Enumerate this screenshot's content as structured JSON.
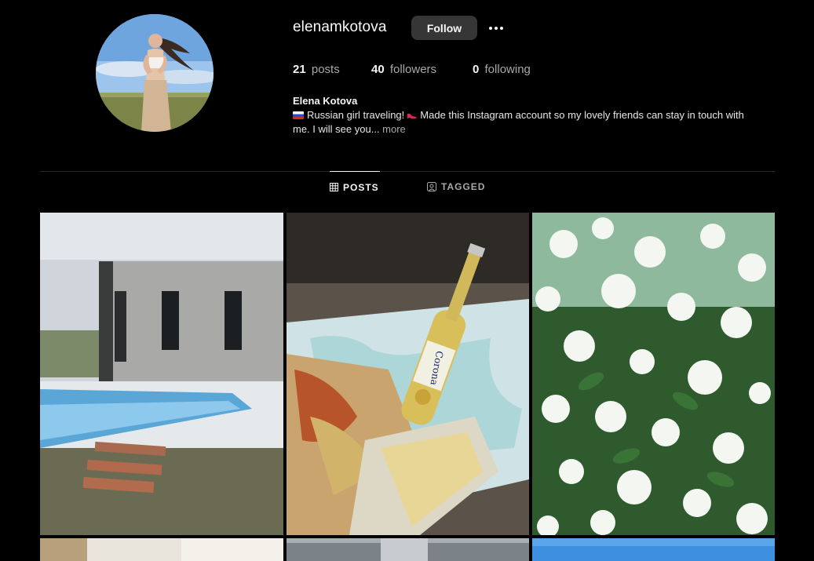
{
  "profile": {
    "username": "elenamkotova",
    "follow_label": "Follow",
    "full_name": "Elena Kotova",
    "bio_text": "Russian girl traveling! 👠 Made this Instagram account so my lovely friends can stay in touch with me. I will see you...",
    "bio_before_emoji": "Russian girl traveling!",
    "bio_after_emoji": "Made this Instagram account so my lovely friends can stay in touch with me. I will see you...",
    "more_label": "more"
  },
  "stats": {
    "posts": {
      "count": "21",
      "label": "posts"
    },
    "followers": {
      "count": "40",
      "label": "followers"
    },
    "following": {
      "count": "0",
      "label": "following"
    }
  },
  "tabs": [
    {
      "label": "POSTS",
      "icon": "grid-icon",
      "active": true
    },
    {
      "label": "TAGGED",
      "icon": "tagged-icon",
      "active": false
    }
  ],
  "grid": {
    "tiles": [
      "house-pool",
      "corona-beer-food",
      "white-flowers",
      "interior",
      "hallway",
      "blue-sky"
    ]
  },
  "colors": {
    "background": "#000000",
    "button": "#363636",
    "secondary_text": "#a8a8a8",
    "divider": "#262626"
  }
}
